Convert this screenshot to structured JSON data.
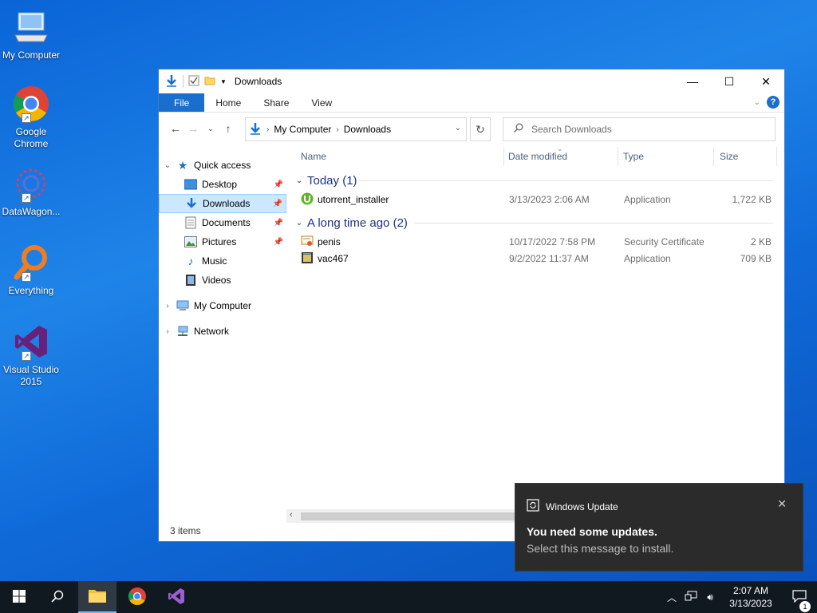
{
  "desktop": {
    "icons": [
      {
        "label": "My Computer",
        "icon": "computer-icon"
      },
      {
        "label": "Google Chrome",
        "icon": "chrome-icon"
      },
      {
        "label": "DataWagon...",
        "icon": "datawagon-icon"
      },
      {
        "label": "Everything",
        "icon": "everything-search-icon"
      },
      {
        "label": "Visual Studio 2015",
        "icon": "visual-studio-icon"
      }
    ]
  },
  "window": {
    "title": "Downloads",
    "ribbon_tabs": [
      "File",
      "Home",
      "Share",
      "View"
    ],
    "help": "?",
    "breadcrumb": [
      "My Computer",
      "Downloads"
    ],
    "search_placeholder": "Search Downloads",
    "nav": {
      "quick_access": "Quick access",
      "pinned": [
        "Desktop",
        "Downloads",
        "Documents",
        "Pictures"
      ],
      "unpinned": [
        "Music",
        "Videos"
      ],
      "my_computer": "My Computer",
      "network": "Network"
    },
    "columns": [
      "Name",
      "Date modified",
      "Type",
      "Size"
    ],
    "groups": [
      {
        "label": "Today (1)",
        "files": [
          {
            "name": "utorrent_installer",
            "date": "3/13/2023 2:06 AM",
            "type": "Application",
            "size": "1,722 KB",
            "icon": "utorrent-icon"
          }
        ]
      },
      {
        "label": "A long time ago (2)",
        "files": [
          {
            "name": "penis",
            "date": "10/17/2022 7:58 PM",
            "type": "Security Certificate",
            "size": "2 KB",
            "icon": "certificate-icon"
          },
          {
            "name": "vac467",
            "date": "9/2/2022 11:37 AM",
            "type": "Application",
            "size": "709 KB",
            "icon": "application-icon"
          }
        ]
      }
    ],
    "status": "3 items"
  },
  "toast": {
    "app": "Windows Update",
    "title": "You need some updates.",
    "body": "Select this message to install."
  },
  "taskbar": {
    "time": "2:07 AM",
    "date": "3/13/2023",
    "notification_count": "1"
  },
  "colors": {
    "accent": "#1a6fce",
    "selection": "#cce8ff",
    "group_header": "#1e3287",
    "taskbar": "#101820",
    "toast": "#2b2b2b"
  }
}
